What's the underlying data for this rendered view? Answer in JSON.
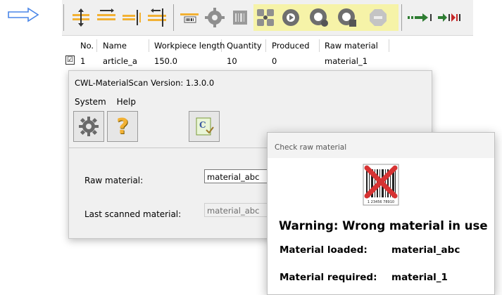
{
  "toolbar": {
    "arrow_icon_color": "#4a86e8",
    "highlight_color": "#f6f3a8",
    "buttons": [
      "split-vertical-icon",
      "align-left-icon",
      "align-right-icon",
      "align-both-icon",
      "barcode-strip-icon",
      "gear-disabled-icon",
      "scan-disabled-icon",
      "network-disabled-icon",
      "round-arrow-icon",
      "scan-search-icon",
      "scan-check-icon",
      "stop-disabled-icon",
      "forward-green-icon",
      "skip-red-icon"
    ]
  },
  "grid": {
    "headers": [
      "No.",
      "Name",
      "Workpiece length",
      "Quantity",
      "Produced",
      "Raw material"
    ],
    "row": {
      "checked": "☑",
      "no": "1",
      "name": "article_a",
      "length": "150.0",
      "quantity": "10",
      "produced": "0",
      "material": "material_1"
    }
  },
  "app": {
    "title": "CWL-MaterialScan  Version: 1.3.0.0",
    "menu": {
      "system": "System",
      "help": "Help"
    },
    "help_glyph": "?",
    "raw_label": "Raw material:",
    "raw_value": "material_abc",
    "last_label": "Last scanned material:",
    "last_value": "material_abc"
  },
  "dialog": {
    "title": "Check raw material",
    "barcode_number": "1 23456 78910",
    "warning": "Warning: Wrong material in use",
    "loaded_label": "Material loaded:",
    "loaded_value": "material_abc",
    "required_label": "Material required:",
    "required_value": "material_1"
  }
}
